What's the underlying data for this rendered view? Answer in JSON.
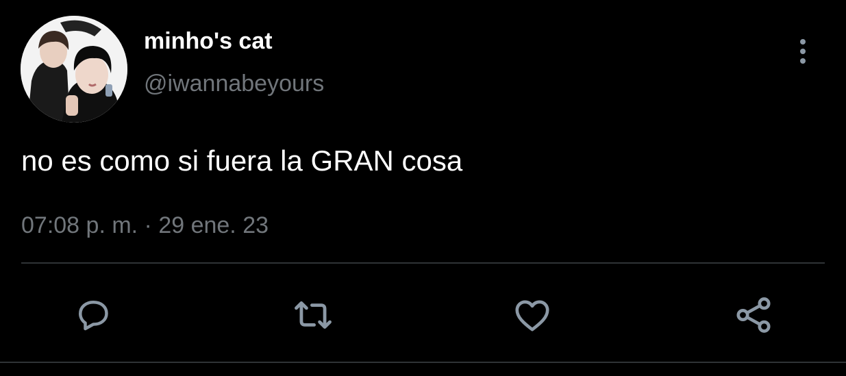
{
  "tweet": {
    "display_name": "minho's cat",
    "handle": "@iwannabeyours",
    "text": "no es como si fuera la GRAN cosa",
    "timestamp": "07:08 p. m. · 29 ene. 23"
  },
  "icons": {
    "more": "more-vertical-icon",
    "reply": "reply-icon",
    "retweet": "retweet-icon",
    "like": "heart-icon",
    "share": "share-icon"
  },
  "colors": {
    "background": "#000000",
    "primary_text": "#ffffff",
    "secondary_text": "#71767b",
    "icon": "#8b98a5",
    "divider": "#2f3336"
  }
}
